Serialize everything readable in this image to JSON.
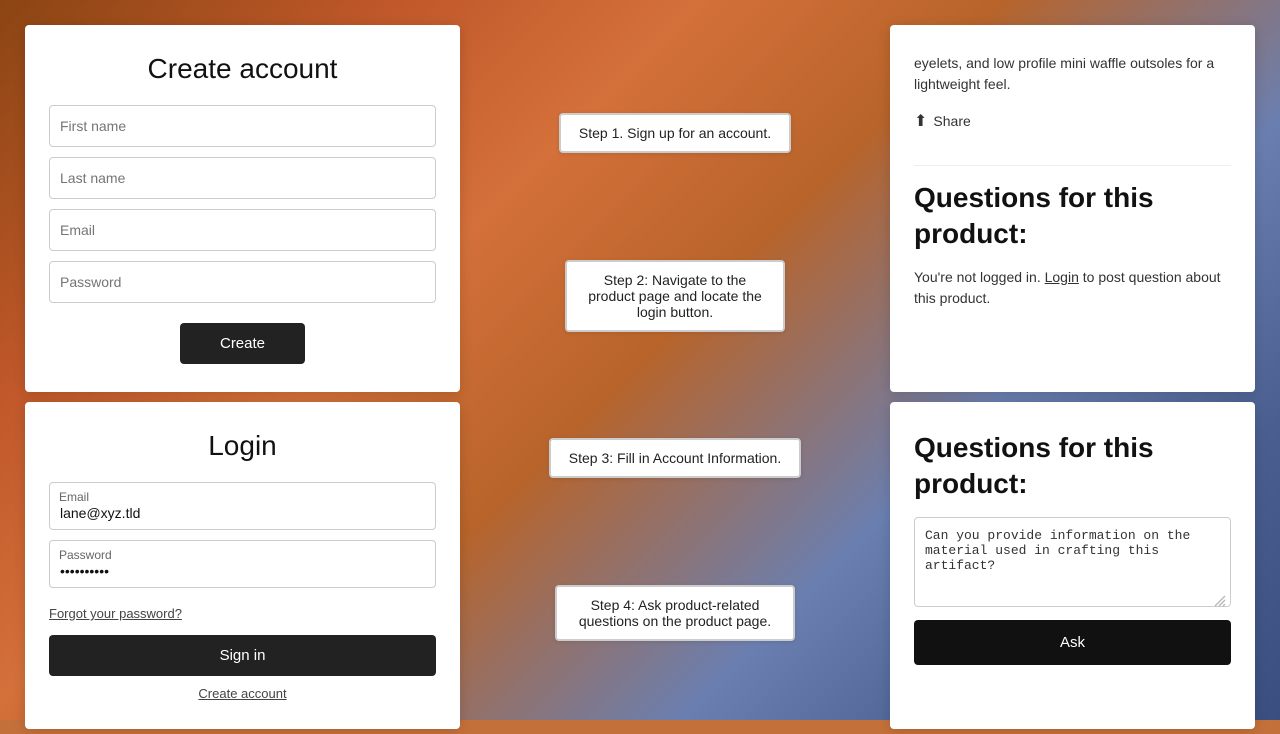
{
  "background": {
    "gradient": "linear-gradient(135deg, #8b4513 0%, #c0582a 20%, #d4703a 35%, #b8642a 50%, #6a7fb0 70%, #4a5f90 85%, #3a4f80 100%)"
  },
  "create_account_card": {
    "title": "Create account",
    "first_name_placeholder": "First name",
    "last_name_placeholder": "Last name",
    "email_placeholder": "Email",
    "password_placeholder": "Password",
    "create_button_label": "Create"
  },
  "login_card": {
    "title": "Login",
    "email_label": "Email",
    "email_value": "lane@xyz.tld",
    "password_label": "Password",
    "password_value": "••••••••••",
    "forgot_password_label": "Forgot your password?",
    "sign_in_button_label": "Sign in",
    "create_account_link_label": "Create account"
  },
  "steps": [
    {
      "id": 1,
      "text": "Step 1. Sign up for an account."
    },
    {
      "id": 2,
      "text": "Step 2: Navigate to the product page\nand locate the login button."
    },
    {
      "id": 3,
      "text": "Step 3: Fill in Account Information."
    },
    {
      "id": 4,
      "text": "Step 4: Ask product-related questions\non the product page."
    }
  ],
  "product_top_card": {
    "description": "eyelets, and low profile mini waffle outsoles for a lightweight feel.",
    "share_label": "Share",
    "questions_title": "Questions for this product:",
    "not_logged_in_text": "You're not logged in.",
    "login_link_label": "Login",
    "post_question_text": "to post question about this product."
  },
  "product_bottom_card": {
    "questions_title": "Questions for this product:",
    "textarea_value": "Can you provide information on the material used in crafting this artifact?",
    "ask_button_label": "Ask"
  }
}
